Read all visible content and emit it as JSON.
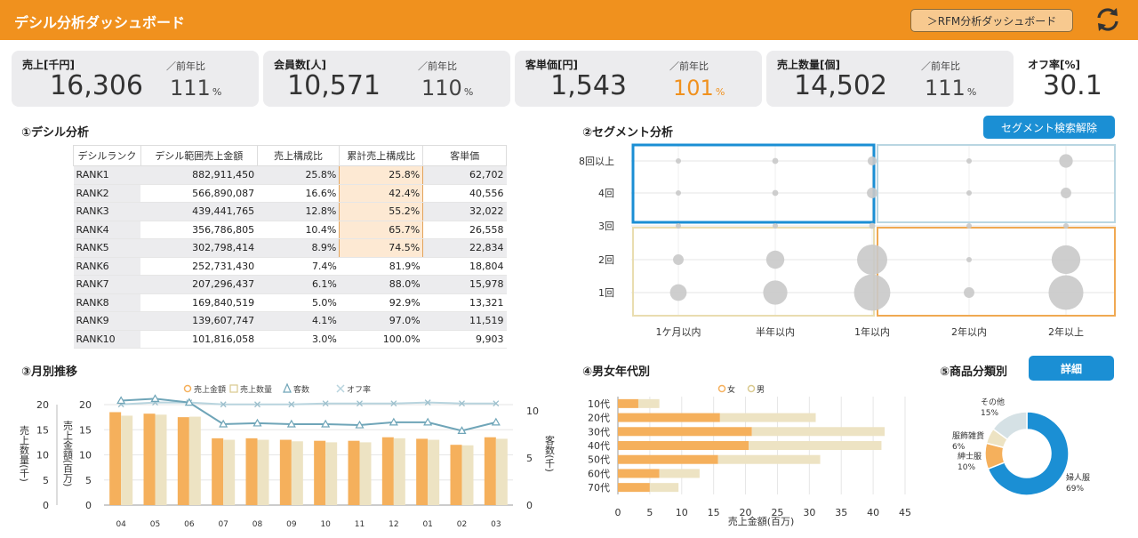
{
  "header": {
    "title": "デシル分析ダッシュボード",
    "rfm_button": "＞RFM分析ダッシュボード"
  },
  "kpis": [
    {
      "label": "売上[千円]",
      "value": "16,306",
      "yoy_label": "／前年比",
      "yoy": "111",
      "unit": "%",
      "yoy_color": "#444"
    },
    {
      "label": "会員数[人]",
      "value": "10,571",
      "yoy_label": "／前年比",
      "yoy": "110",
      "unit": "%",
      "yoy_color": "#444"
    },
    {
      "label": "客単価[円]",
      "value": "1,543",
      "yoy_label": "／前年比",
      "yoy": "101",
      "unit": "%",
      "yoy_color": "#f0911e"
    },
    {
      "label": "売上数量[個]",
      "value": "14,502",
      "yoy_label": "／前年比",
      "yoy": "111",
      "unit": "%",
      "yoy_color": "#444"
    }
  ],
  "off_rate": {
    "label": "オフ率[%]",
    "value": "30.1"
  },
  "decile": {
    "title": "①デシル分析",
    "headers": [
      "デシルランク",
      "デシル範囲売上金額",
      "売上構成比",
      "累計売上構成比",
      "客単価"
    ],
    "rows": [
      [
        "RANK1",
        "882,911,450",
        "25.8%",
        "25.8%",
        "62,702"
      ],
      [
        "RANK2",
        "566,890,087",
        "16.6%",
        "42.4%",
        "40,556"
      ],
      [
        "RANK3",
        "439,441,765",
        "12.8%",
        "55.2%",
        "32,022"
      ],
      [
        "RANK4",
        "356,786,805",
        "10.4%",
        "65.7%",
        "26,558"
      ],
      [
        "RANK5",
        "302,798,414",
        "8.9%",
        "74.5%",
        "22,834"
      ],
      [
        "RANK6",
        "252,731,430",
        "7.4%",
        "81.9%",
        "18,804"
      ],
      [
        "RANK7",
        "207,296,437",
        "6.1%",
        "88.0%",
        "15,978"
      ],
      [
        "RANK8",
        "169,840,519",
        "5.0%",
        "92.9%",
        "13,321"
      ],
      [
        "RANK9",
        "139,607,747",
        "4.1%",
        "97.0%",
        "11,519"
      ],
      [
        "RANK10",
        "101,816,058",
        "3.0%",
        "100.0%",
        "9,903"
      ]
    ]
  },
  "segment": {
    "title": "②セグメント分析",
    "button": "セグメント検索解除",
    "y_labels": [
      "8回以上",
      "4回",
      "3回",
      "2回",
      "1回"
    ],
    "x_labels": [
      "1ケ月以内",
      "半年以内",
      "1年以内",
      "2年以内",
      "2年以上"
    ],
    "colors": {
      "topleft": "#1b8fd4",
      "topright": "#b9d6e2",
      "bottomleft": "#e9ddb0",
      "bottomright": "#f0a952"
    }
  },
  "monthly": {
    "title": "③月別推移",
    "legend": [
      "売上金額",
      "売上数量",
      "客数",
      "オフ率"
    ],
    "y_left_outer_label": "売上数量(千)",
    "y_left_inner_label": "売上金額(百万)",
    "y_right_label": "客数(千)"
  },
  "age": {
    "title": "④男女年代別",
    "legend": [
      "女",
      "男"
    ],
    "xlabel": "売上金額(百万)"
  },
  "category": {
    "title": "⑤商品分類別",
    "button": "詳細"
  },
  "chart_data": [
    {
      "type": "bar",
      "title": "③月別推移",
      "categories": [
        "04",
        "05",
        "06",
        "07",
        "08",
        "09",
        "10",
        "11",
        "12",
        "01",
        "02",
        "03"
      ],
      "y_left_ticks": [
        0,
        5,
        10,
        15,
        20
      ],
      "y_right_ticks": [
        0,
        5,
        10
      ],
      "ylim": [
        0,
        20
      ],
      "y2lim": [
        0,
        12
      ],
      "series": [
        {
          "name": "売上金額",
          "kind": "bar",
          "color": "#f5b05c",
          "values": [
            18.5,
            18.2,
            17.5,
            13.3,
            13.3,
            13.0,
            12.8,
            12.8,
            13.5,
            13.2,
            12.0,
            13.5
          ]
        },
        {
          "name": "売上数量",
          "kind": "bar",
          "color": "#ede3c3",
          "values": [
            17.8,
            18.0,
            17.6,
            13.0,
            13.0,
            12.7,
            12.5,
            12.5,
            13.3,
            13.0,
            11.9,
            13.2
          ]
        },
        {
          "name": "客数",
          "kind": "line",
          "color": "#6fa5b8",
          "axis": "right",
          "values": [
            11.1,
            11.3,
            10.9,
            8.6,
            8.7,
            8.6,
            8.6,
            8.5,
            8.8,
            8.8,
            7.9,
            8.8
          ]
        },
        {
          "name": "オフ率",
          "kind": "line",
          "color": "#b8d4de",
          "axis": "right",
          "values": [
            10.7,
            10.9,
            10.9,
            10.7,
            10.7,
            10.7,
            10.8,
            10.8,
            10.8,
            10.9,
            10.8,
            10.8
          ]
        }
      ]
    },
    {
      "type": "bar",
      "orientation": "horizontal",
      "stacked": true,
      "title": "④男女年代別",
      "categories": [
        "10代",
        "20代",
        "30代",
        "40代",
        "50代",
        "60代",
        "70代"
      ],
      "x_ticks": [
        0,
        5,
        10,
        15,
        20,
        25,
        30,
        35,
        40,
        45
      ],
      "xlim": [
        0,
        45
      ],
      "xlabel": "売上金額(百万)",
      "series": [
        {
          "name": "女",
          "color": "#f5b05c",
          "values": [
            3.2,
            16.0,
            21.0,
            20.5,
            15.7,
            6.5,
            5.0
          ]
        },
        {
          "name": "男",
          "color": "#ede3c3",
          "values": [
            3.3,
            15.0,
            20.8,
            20.8,
            16.0,
            6.3,
            4.5
          ]
        }
      ]
    },
    {
      "type": "pie",
      "title": "⑤商品分類別",
      "donut": true,
      "slices": [
        {
          "label": "婦人服",
          "value": 69,
          "pct": "69%",
          "color": "#1b8fd4"
        },
        {
          "label": "紳士服",
          "value": 10,
          "pct": "10%",
          "color": "#f5b05c"
        },
        {
          "label": "服飾雑貨",
          "value": 6,
          "pct": "6%",
          "color": "#ede3c3"
        },
        {
          "label": "その他",
          "value": 15,
          "pct": "15%",
          "color": "#d5e1e5"
        }
      ]
    },
    {
      "type": "scatter",
      "title": "②セグメント分析",
      "x_categories": [
        "1ケ月以内",
        "半年以内",
        "1年以内",
        "2年以内",
        "2年以上"
      ],
      "y_categories": [
        "1回",
        "2回",
        "3回",
        "4回",
        "8回以上"
      ],
      "points": [
        {
          "x": "1ケ月以内",
          "y": "8回以上",
          "size": 3
        },
        {
          "x": "半年以内",
          "y": "8回以上",
          "size": 4
        },
        {
          "x": "1年以内",
          "y": "8回以上",
          "size": 6
        },
        {
          "x": "2年以内",
          "y": "8回以上",
          "size": 1
        },
        {
          "x": "2年以上",
          "y": "8回以上",
          "size": 9
        },
        {
          "x": "1ケ月以内",
          "y": "4回",
          "size": 2
        },
        {
          "x": "半年以内",
          "y": "4回",
          "size": 4
        },
        {
          "x": "1年以内",
          "y": "4回",
          "size": 7
        },
        {
          "x": "2年以内",
          "y": "4回",
          "size": 1
        },
        {
          "x": "2年以上",
          "y": "4回",
          "size": 7
        },
        {
          "x": "1ケ月以内",
          "y": "3回",
          "size": 1
        },
        {
          "x": "半年以内",
          "y": "3回",
          "size": 2
        },
        {
          "x": "1年以内",
          "y": "3回",
          "size": 4
        },
        {
          "x": "2年以内",
          "y": "3回",
          "size": 1
        },
        {
          "x": "2年以上",
          "y": "3回",
          "size": 3
        },
        {
          "x": "1ケ月以内",
          "y": "2回",
          "size": 7
        },
        {
          "x": "半年以内",
          "y": "2回",
          "size": 12
        },
        {
          "x": "1年以内",
          "y": "2回",
          "size": 20
        },
        {
          "x": "2年以内",
          "y": "2回",
          "size": 3
        },
        {
          "x": "2年以上",
          "y": "2回",
          "size": 19
        },
        {
          "x": "1ケ月以内",
          "y": "1回",
          "size": 11
        },
        {
          "x": "半年以内",
          "y": "1回",
          "size": 16
        },
        {
          "x": "1年以内",
          "y": "1回",
          "size": 24
        },
        {
          "x": "2年以内",
          "y": "1回",
          "size": 7
        },
        {
          "x": "2年以上",
          "y": "1回",
          "size": 23
        }
      ]
    }
  ]
}
